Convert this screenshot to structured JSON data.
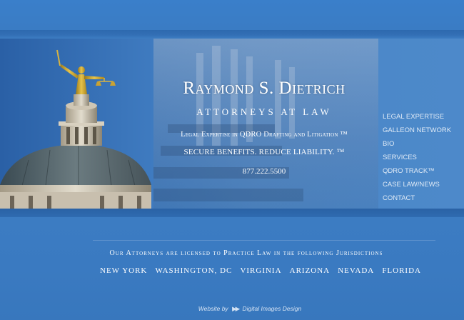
{
  "header": {
    "firm_name": "Raymond S. Dietrich",
    "tagline": "Attorneys at Law",
    "line1": "Legal Expertise in QDRO Drafting and Litigation ™",
    "line2": "SECURE BENEFITS. REDUCE LIABILITY. ™",
    "phone": "877.222.5500"
  },
  "nav": {
    "items": [
      {
        "label": "LEGAL EXPERTISE"
      },
      {
        "label": "GALLEON NETWORK"
      },
      {
        "label": "BIO"
      },
      {
        "label": "SERVICES"
      },
      {
        "label": "QDRO TRACK™"
      },
      {
        "label": "CASE LAW/NEWS"
      },
      {
        "label": "CONTACT"
      }
    ]
  },
  "jurisdictions": {
    "title": "Our Attorneys are licensed to Practice Law in the following Jurisdictions",
    "states": [
      "NEW YORK",
      "WASHINGTON, DC",
      "VIRGINIA",
      "ARIZONA",
      "NEVADA",
      "FLORIDA"
    ]
  },
  "footer": {
    "credit_prefix": "Website by",
    "credit_company": "Digital Images Design"
  },
  "colors": {
    "background": "#3a7cc2",
    "text": "#ffffff",
    "nav_text": "#dfeaf6"
  },
  "icons": {
    "statue": "lady-justice-statue",
    "dome": "courthouse-dome",
    "credit": "double-arrow-icon"
  }
}
